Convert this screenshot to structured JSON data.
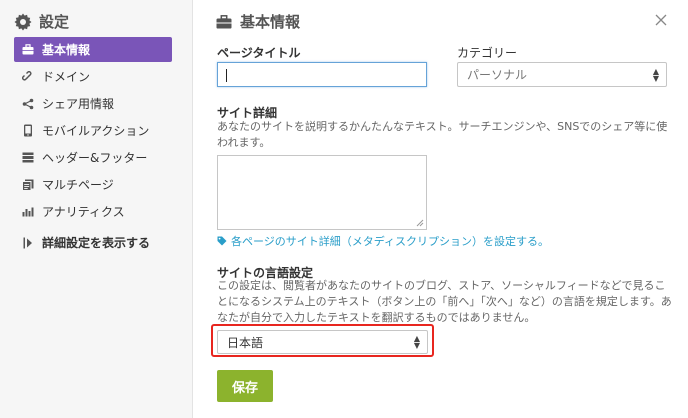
{
  "sidebar": {
    "title": "設定",
    "items": [
      {
        "label": "基本情報",
        "icon": "briefcase-icon"
      },
      {
        "label": "ドメイン",
        "icon": "link-icon"
      },
      {
        "label": "シェア用情報",
        "icon": "share-icon"
      },
      {
        "label": "モバイルアクション",
        "icon": "mobile-icon"
      },
      {
        "label": "ヘッダー&フッター",
        "icon": "layout-icon"
      },
      {
        "label": "マルチページ",
        "icon": "pages-icon"
      },
      {
        "label": "アナリティクス",
        "icon": "bar-chart-icon"
      }
    ],
    "advanced_label": "詳細設定を表示する"
  },
  "panel": {
    "title": "基本情報",
    "page_title_label": "ページタイトル",
    "page_title_value": "",
    "category_label": "カテゴリー",
    "category_value": "パーソナル",
    "site_detail_label": "サイト詳細",
    "site_detail_desc": "あなたのサイトを説明するかんたんなテキスト。サーチエンジンや、SNSでのシェア等に使われます。",
    "site_detail_value": "",
    "meta_hint": "各ページのサイト詳細（メタディスクリプション）を設定する。",
    "language_label": "サイトの言語設定",
    "language_desc": "この設定は、閲覧者があなたのサイトのブログ、ストア、ソーシャルフィードなどで見ることになるシステム上のテキスト（ボタン上の「前へ」「次へ」など）の言語を規定します。あなたが自分で入力したテキストを翻訳するものではありません。",
    "language_value": "日本語",
    "save_label": "保存"
  },
  "colors": {
    "accent": "#7a55b8",
    "save": "#8cb32d",
    "link": "#2a9ec9",
    "highlight": "#e8261f"
  }
}
